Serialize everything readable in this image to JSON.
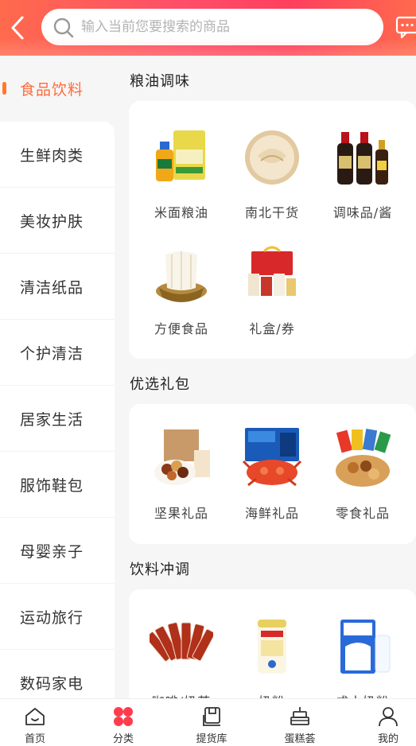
{
  "header": {
    "search_placeholder": "输入当前您要搜索的商品"
  },
  "sidebar": {
    "items": [
      {
        "label": "食品饮料",
        "active": true
      },
      {
        "label": "生鲜肉类"
      },
      {
        "label": "美妆护肤"
      },
      {
        "label": "清洁纸品"
      },
      {
        "label": "个护清洁"
      },
      {
        "label": "居家生活"
      },
      {
        "label": "服饰鞋包"
      },
      {
        "label": "母婴亲子"
      },
      {
        "label": "运动旅行"
      },
      {
        "label": "数码家电"
      }
    ]
  },
  "sections": [
    {
      "title": "粮油调味",
      "items": [
        {
          "label": "米面粮油",
          "icon": "rice-oil-image"
        },
        {
          "label": "南北干货",
          "icon": "dried-goods-image"
        },
        {
          "label": "调味品/酱",
          "icon": "sauce-image"
        },
        {
          "label": "方便食品",
          "icon": "instant-noodles-image"
        },
        {
          "label": "礼盒/券",
          "icon": "gift-box-image"
        }
      ]
    },
    {
      "title": "优选礼包",
      "items": [
        {
          "label": "坚果礼品",
          "icon": "nuts-gift-image"
        },
        {
          "label": "海鲜礼品",
          "icon": "seafood-gift-image"
        },
        {
          "label": "零食礼品",
          "icon": "snacks-gift-image"
        }
      ]
    },
    {
      "title": "饮料冲调",
      "items": [
        {
          "label": "咖啡/奶茶",
          "icon": "coffee-image"
        },
        {
          "label": "奶粉",
          "icon": "milk-powder-image"
        },
        {
          "label": "成人奶粉",
          "icon": "adult-milk-powder-image"
        }
      ]
    }
  ],
  "tabbar": {
    "tabs": [
      {
        "label": "首页",
        "icon": "home-icon"
      },
      {
        "label": "分类",
        "icon": "category-icon",
        "active": true
      },
      {
        "label": "提货库",
        "icon": "pickup-icon"
      },
      {
        "label": "蛋糕荟",
        "icon": "cake-icon"
      },
      {
        "label": "我的",
        "icon": "profile-icon"
      }
    ]
  },
  "colors": {
    "accent": "#ff6b3d",
    "header_gradient": "#ff4d6a",
    "active_tab": "#ff3b4d"
  }
}
